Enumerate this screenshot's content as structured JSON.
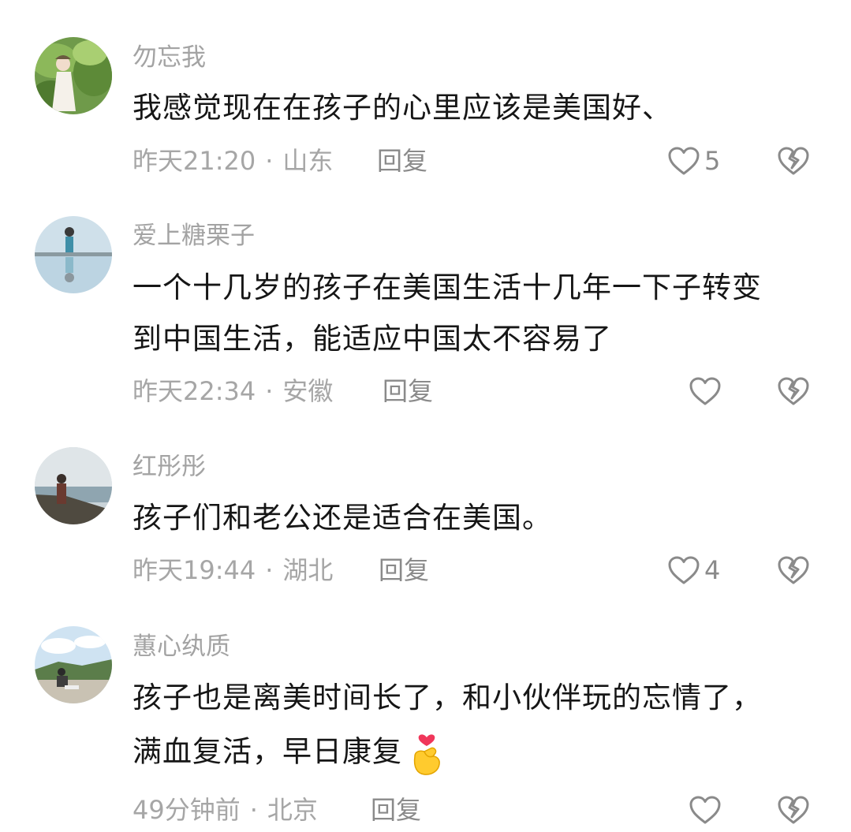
{
  "comments": [
    {
      "username": "勿忘我",
      "lines": [
        "我感觉现在在孩子的心里应该是美国好、"
      ],
      "time": "昨天21:20",
      "location": "山东",
      "reply_label": "回复",
      "likes": "5"
    },
    {
      "username": "爱上糖栗子",
      "lines": [
        "一个十几岁的孩子在美国生活十几年一下子转变",
        "到中国生活，能适应中国太不容易了"
      ],
      "time": "昨天22:34",
      "location": "安徽",
      "reply_label": "回复",
      "likes": ""
    },
    {
      "username": "红彤彤",
      "lines": [
        "孩子们和老公还是适合在美国。"
      ],
      "time": "昨天19:44",
      "location": "湖北",
      "reply_label": "回复",
      "likes": "4"
    },
    {
      "username": "蕙心纨质",
      "lines": [
        "孩子也是离美时间长了，和小伙伴玩的忘情了，",
        "满血复活，早日康复"
      ],
      "time": "49分钟前",
      "location": "北京",
      "reply_label": "回复",
      "likes": ""
    }
  ],
  "separator": "·",
  "icons": {
    "like": "heart-outline-icon",
    "dislike": "broken-heart-icon",
    "emoji": "finger-heart-emoji"
  },
  "colors": {
    "text": "#161616",
    "muted": "#a6a6a6",
    "icon": "#8a8a8a"
  }
}
